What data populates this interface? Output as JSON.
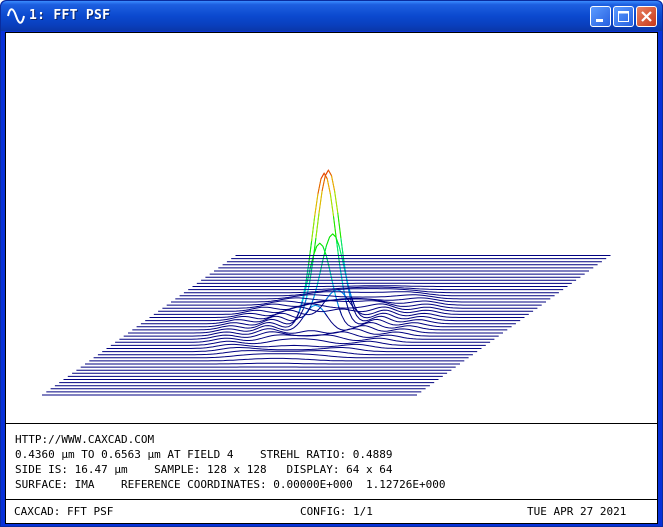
{
  "window": {
    "title": "1: FFT PSF",
    "icon": "sine-wave-icon",
    "controls": [
      "minimize-icon",
      "maximize-icon",
      "close-icon"
    ]
  },
  "info": {
    "line1": "HTTP://WWW.CAXCAD.COM",
    "line2": "0.4360 µm TO 0.6563 µm AT FIELD 4    STREHL RATIO: 0.4889",
    "line3": "SIDE IS: 16.47 µm    SAMPLE: 128 x 128   DISPLAY: 64 x 64",
    "line4": "SURFACE: IMA    REFERENCE COORDINATES: 0.00000E+000  1.12726E+000"
  },
  "status": {
    "left": "CAXCAD: FFT PSF",
    "center": "CONFIG: 1/1",
    "right": "TUE APR 27 2021"
  },
  "colors": {
    "plot_line": "#000080",
    "titlebar": "#0b49cf",
    "close_button": "#c8391a"
  }
}
